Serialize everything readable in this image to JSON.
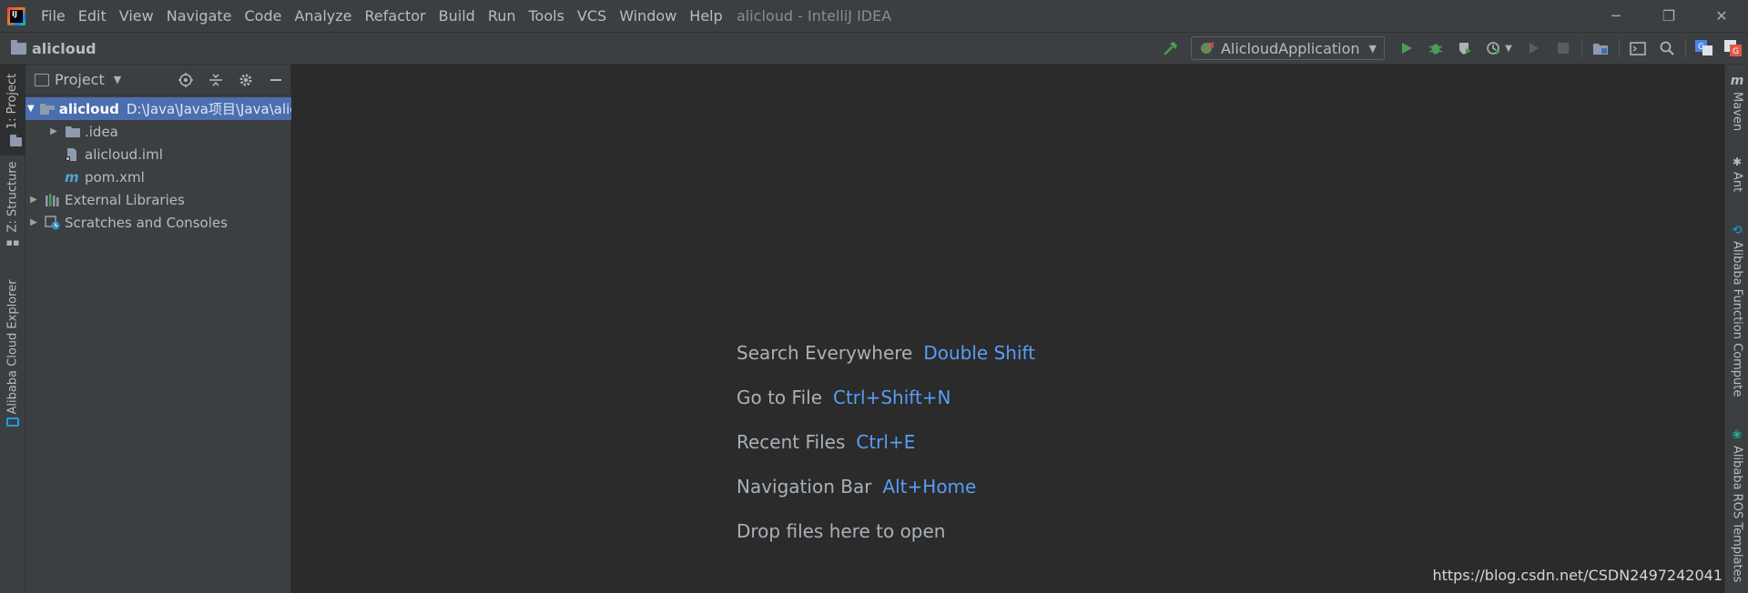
{
  "window": {
    "app_name": "IntelliJ IDEA",
    "title": "alicloud - IntelliJ IDEA",
    "logo_text": "IJ"
  },
  "menu": {
    "items": [
      "File",
      "Edit",
      "View",
      "Navigate",
      "Code",
      "Analyze",
      "Refactor",
      "Build",
      "Run",
      "Tools",
      "VCS",
      "Window",
      "Help"
    ]
  },
  "window_controls": {
    "minimize": "─",
    "restore": "❐",
    "close": "✕"
  },
  "navbar": {
    "breadcrumb": "alicloud",
    "run_configuration": "AlicloudApplication"
  },
  "left_strip": {
    "tabs": [
      "1: Project",
      "Z: Structure",
      "Alibaba Cloud Explorer"
    ]
  },
  "right_strip": {
    "tabs": [
      "Maven",
      "Ant",
      "Alibaba Function Compute",
      "Alibaba ROS Templates"
    ]
  },
  "project_panel": {
    "title": "Project",
    "tree": [
      {
        "label": "alicloud",
        "path": "D:\\Java\\Java项目\\Java\\alicloud",
        "icon": "module-folder-icon",
        "expanded": true,
        "selected": true,
        "depth": 0
      },
      {
        "label": ".idea",
        "icon": "folder-icon",
        "expanded": false,
        "depth": 1
      },
      {
        "label": "alicloud.iml",
        "icon": "iml-file-icon",
        "depth": 1
      },
      {
        "label": "pom.xml",
        "icon": "maven-file-icon",
        "depth": 1
      },
      {
        "label": "External Libraries",
        "icon": "libraries-icon",
        "expanded": false,
        "depth": 0
      },
      {
        "label": "Scratches and Consoles",
        "icon": "scratches-icon",
        "expanded": false,
        "depth": 0
      }
    ]
  },
  "editor": {
    "hints": [
      {
        "label": "Search Everywhere",
        "shortcut": "Double Shift"
      },
      {
        "label": "Go to File",
        "shortcut": "Ctrl+Shift+N"
      },
      {
        "label": "Recent Files",
        "shortcut": "Ctrl+E"
      },
      {
        "label": "Navigation Bar",
        "shortcut": "Alt+Home"
      },
      {
        "label": "Drop files here to open",
        "shortcut": ""
      }
    ]
  },
  "watermark": "https://blog.csdn.net/CSDN2497242041",
  "colors": {
    "background": "#2b2b2b",
    "panel": "#3c3f41",
    "selection": "#4b6eaf",
    "shortcut": "#589df6",
    "run_green": "#499c54"
  }
}
